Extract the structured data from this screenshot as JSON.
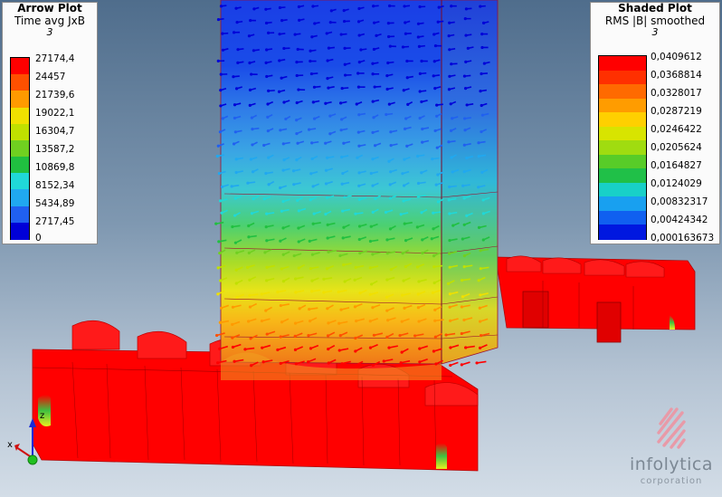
{
  "arrow_legend": {
    "title": "Arrow Plot",
    "subtitle": "Time avg JxB",
    "step": "3",
    "values": [
      "27174,4",
      "24457",
      "21739,6",
      "19022,1",
      "16304,7",
      "13587,2",
      "10869,8",
      "8152,34",
      "5434,89",
      "2717,45",
      "0"
    ],
    "colors": [
      "#ff0000",
      "#ff5000",
      "#ff9a00",
      "#f0e000",
      "#c0e000",
      "#70d020",
      "#20c040",
      "#20d8d8",
      "#20a8f0",
      "#2060f0",
      "#0000d8"
    ]
  },
  "shaded_legend": {
    "title": "Shaded Plot",
    "subtitle": "RMS |B| smoothed",
    "step": "3",
    "values": [
      "0,0409612",
      "0,0368814",
      "0,0328017",
      "0,0287219",
      "0,0246422",
      "0,0205624",
      "0,0164827",
      "0,0124029",
      "0,00832317",
      "0,00424342",
      "0,000163673"
    ],
    "colors": [
      "#ff0000",
      "#ff3000",
      "#ff6a00",
      "#ff9c00",
      "#ffd000",
      "#d8e400",
      "#a0dc10",
      "#58cc28",
      "#20c048",
      "#18d0c8",
      "#18a0f0",
      "#1060f0",
      "#0018e0"
    ]
  },
  "triad": {
    "z": "z",
    "x": "x"
  },
  "logo": {
    "name": "infolytica",
    "corp": "corporation"
  }
}
